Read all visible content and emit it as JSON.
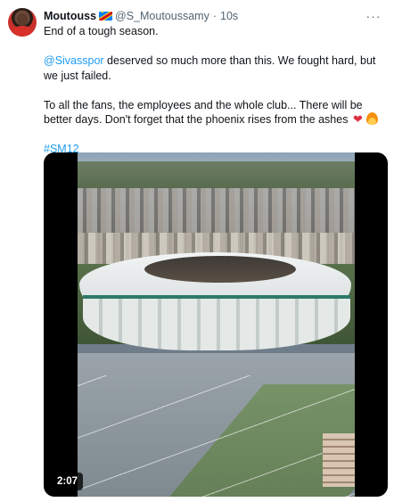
{
  "tweet": {
    "author_name": "Moutouss",
    "flag_icon": "dr-congo-flag-icon",
    "handle": "@S_Moutoussamy",
    "separator": "·",
    "time": "10s",
    "more_icon": "more-options-icon",
    "line1": "End of a tough season.",
    "mention": "@Sivasspor",
    "line2_rest": " deserved so much more than this. We fought hard, but we just failed.",
    "line3": "To all the fans, the employees and the whole club... There will be better days. Don't forget that the phoenix rises from the ashes ",
    "hashtag": "#SM12"
  },
  "media": {
    "type": "video",
    "duration": "2:07"
  },
  "colors": {
    "link": "#1d9bf0",
    "text": "#0f1419",
    "secondary": "#536471"
  }
}
